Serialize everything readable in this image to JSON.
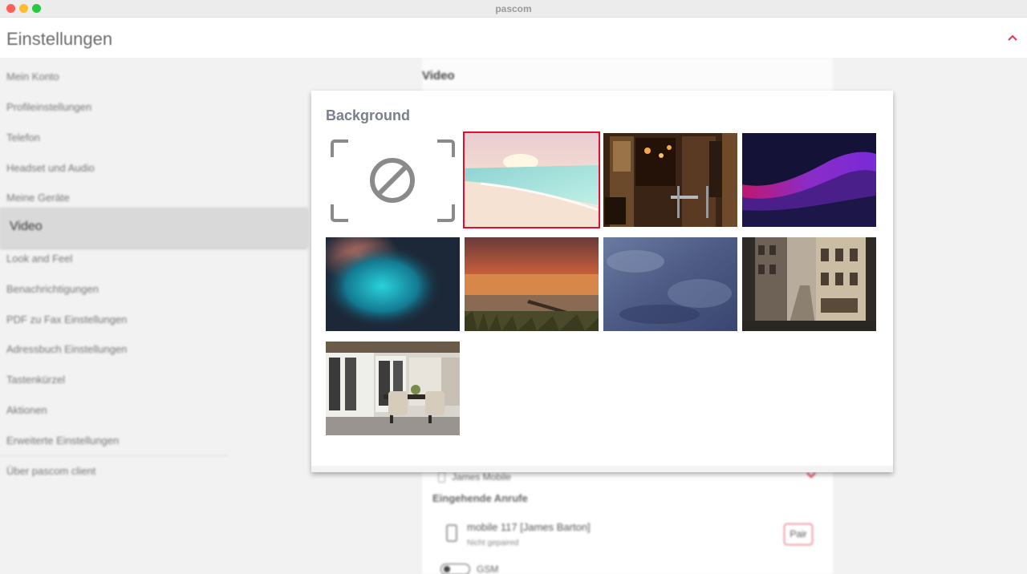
{
  "window": {
    "title": "pascom"
  },
  "header": {
    "title": "Einstellungen",
    "collapse_icon": "chevron-up-icon"
  },
  "sidebar": {
    "items": [
      {
        "label": "Mein Konto"
      },
      {
        "label": "Profileinstellungen"
      },
      {
        "label": "Telefon"
      },
      {
        "label": "Headset und Audio"
      },
      {
        "label": "Meine Geräte"
      },
      {
        "label": "Video",
        "active": true
      },
      {
        "label": "Look and Feel"
      },
      {
        "label": "Benachrichtigungen"
      },
      {
        "label": "PDF zu Fax Einstellungen"
      },
      {
        "label": "Adressbuch Einstellungen"
      },
      {
        "label": "Tastenkürzel"
      },
      {
        "label": "Aktionen"
      },
      {
        "label": "Erweiterte Einstellungen"
      },
      {
        "label": "Über pascom client"
      }
    ]
  },
  "content": {
    "section_title": "Video",
    "device_small": "James Mobile",
    "incoming_title": "Eingehende Anrufe",
    "mobile_name": "mobile 117 [James Barton]",
    "mobile_status": "Nicht gepaired",
    "pair_label": "Pair",
    "gsm_label": "GSM"
  },
  "background_modal": {
    "title": "Background",
    "options": [
      {
        "kind": "none",
        "icon": "no-background-icon"
      },
      {
        "kind": "image",
        "subject": "beach",
        "selected": true
      },
      {
        "kind": "image",
        "subject": "cafe"
      },
      {
        "kind": "image",
        "subject": "purple-wave"
      },
      {
        "kind": "image",
        "subject": "bokeh"
      },
      {
        "kind": "image",
        "subject": "sunset"
      },
      {
        "kind": "image",
        "subject": "blue-texture"
      },
      {
        "kind": "image",
        "subject": "street"
      },
      {
        "kind": "image",
        "subject": "office"
      }
    ]
  },
  "colors": {
    "accent": "#e0405a",
    "selected_outline": "#e0102f"
  }
}
